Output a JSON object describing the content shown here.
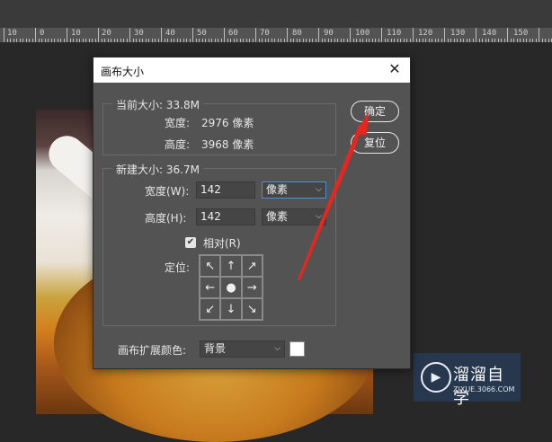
{
  "ruler": {
    "labels": [
      "10",
      "0",
      "10",
      "20",
      "30",
      "40",
      "50",
      "60",
      "70",
      "80",
      "90",
      "100",
      "110",
      "120",
      "130",
      "140",
      "150"
    ]
  },
  "watermark": {
    "logo_icon": "play-icon",
    "title": "溜溜自学",
    "subtitle": "ZIXUE.3066.COM"
  },
  "dialog": {
    "title": "画布大小",
    "close_icon": "close-icon",
    "current": {
      "legend": "当前大小: 33.8M",
      "width_label": "宽度:",
      "width_value": "2976 像素",
      "height_label": "高度:",
      "height_value": "3968 像素"
    },
    "new": {
      "legend": "新建大小: 36.7M",
      "width_label": "宽度(W):",
      "width_value": "142",
      "width_unit": "像素",
      "height_label": "高度(H):",
      "height_value": "142",
      "height_unit": "像素",
      "relative_label": "相对(R)",
      "relative_checked": true,
      "anchor_label": "定位:",
      "anchor_icons": [
        "arrow-up-left-icon",
        "arrow-up-icon",
        "arrow-up-right-icon",
        "arrow-left-icon",
        "center-dot-icon",
        "arrow-right-icon",
        "arrow-down-left-icon",
        "arrow-down-icon",
        "arrow-down-right-icon"
      ]
    },
    "extension_color_label": "画布扩展颜色:",
    "extension_color_value": "背景",
    "extension_swatch_color": "#ffffff",
    "ok_label": "确定",
    "reset_label": "复位"
  },
  "annotation_color": "#e8261f"
}
